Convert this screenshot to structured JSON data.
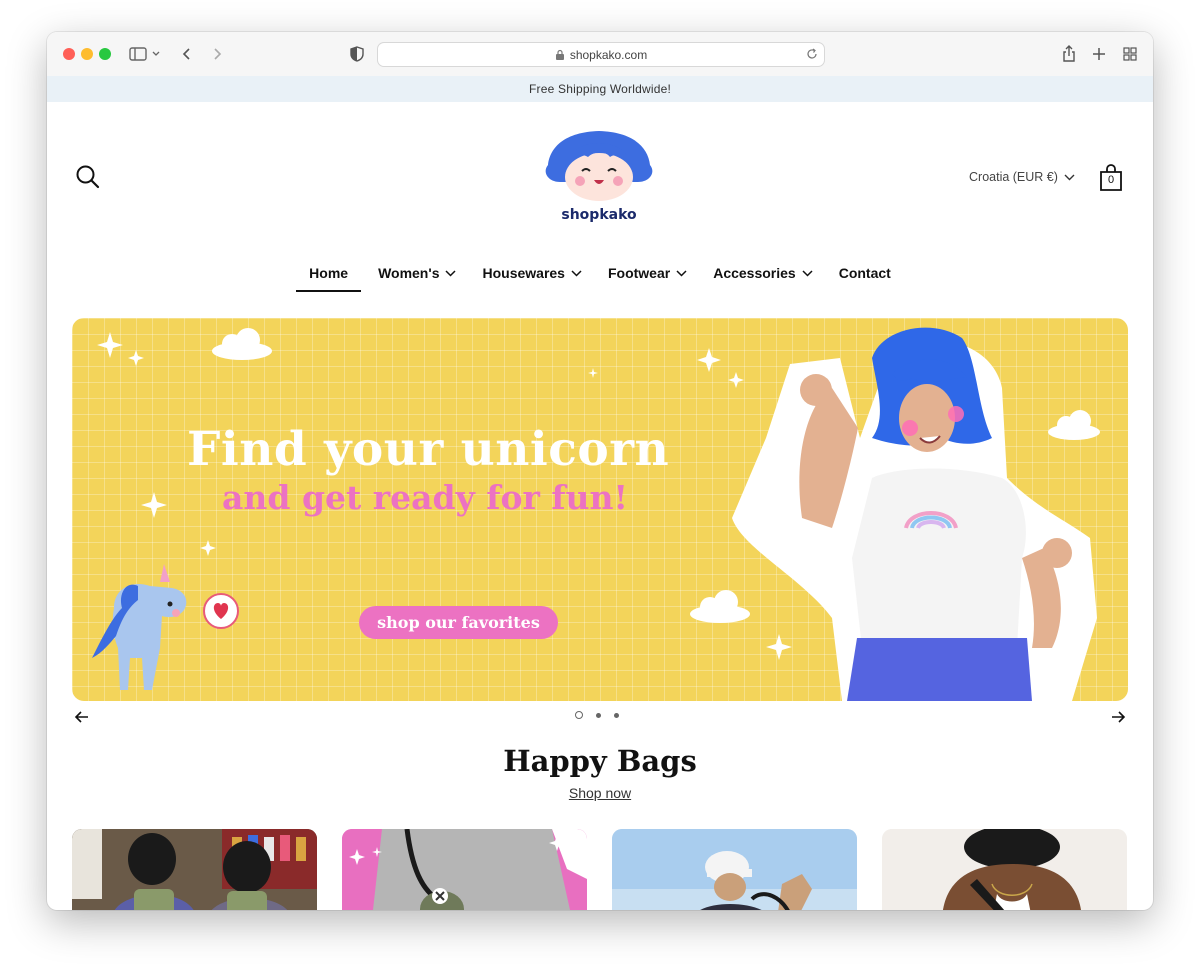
{
  "browser": {
    "url": "shopkako.com"
  },
  "announcement": "Free Shipping Worldwide!",
  "header": {
    "logo_text": "shopkako",
    "country_selector": "Croatia (EUR €)",
    "cart_count": "0"
  },
  "nav": {
    "items": [
      {
        "label": "Home",
        "active": true,
        "dropdown": false
      },
      {
        "label": "Women's",
        "active": false,
        "dropdown": true
      },
      {
        "label": "Housewares",
        "active": false,
        "dropdown": true
      },
      {
        "label": "Footwear",
        "active": false,
        "dropdown": true
      },
      {
        "label": "Accessories",
        "active": false,
        "dropdown": true
      },
      {
        "label": "Contact",
        "active": false,
        "dropdown": false
      }
    ]
  },
  "hero": {
    "title": "Find your unicorn",
    "subtitle": "and get ready for fun!",
    "button": "shop our favorites",
    "slides_total": 3,
    "active_slide": 1
  },
  "section": {
    "title": "Happy Bags",
    "link": "Shop now"
  },
  "colors": {
    "hero_bg": "#f3d45a",
    "accent_pink": "#ec72c2",
    "announcement_bg": "#e9f1f7",
    "logo_blue": "#3d6de0"
  }
}
